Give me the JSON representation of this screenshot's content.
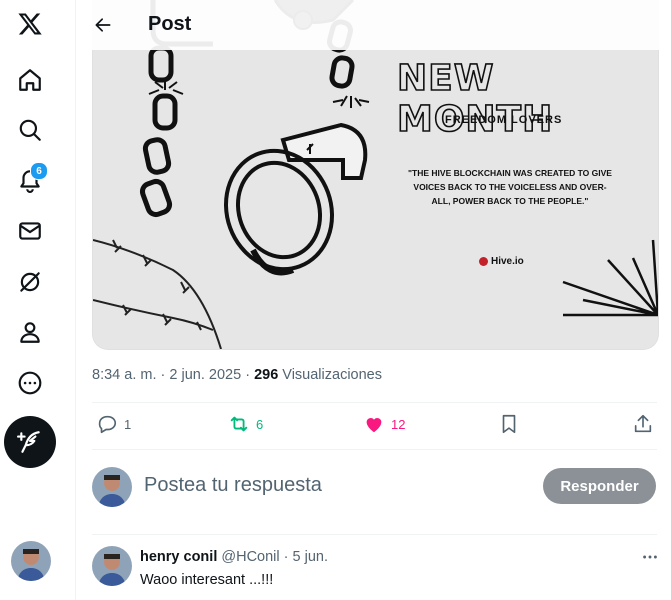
{
  "header": {
    "title": "Post"
  },
  "sidebar": {
    "items": [
      {
        "name": "x-logo"
      },
      {
        "name": "home"
      },
      {
        "name": "explore"
      },
      {
        "name": "notifications",
        "badge": "6"
      },
      {
        "name": "messages"
      },
      {
        "name": "grok"
      },
      {
        "name": "profile"
      },
      {
        "name": "more"
      }
    ],
    "compose": "compose-post"
  },
  "post": {
    "image": {
      "headline": "NEW MONTH",
      "subtitle": "FREEDOM LOVERS",
      "quote": "\"THE HIVE BLOCKCHAIN WAS CREATED TO GIVE VOICES BACK TO THE VOICELESS AND OVER-ALL, POWER BACK TO THE PEOPLE.\"",
      "brand": "Hive.io"
    },
    "time": "8:34 a. m.",
    "sep": "·",
    "date": "2 jun. 2025",
    "views_count": "296",
    "views_label": "Visualizaciones",
    "stats": {
      "replies": "1",
      "reposts": "6",
      "likes": "12"
    }
  },
  "reply_box": {
    "placeholder": "Postea tu respuesta",
    "button": "Responder"
  },
  "comments": [
    {
      "name": "henry conil",
      "handle": "@HConil",
      "sep": "·",
      "date": "5 jun.",
      "text": "Waoo interesant ...!!!"
    }
  ],
  "colors": {
    "like": "#f91880",
    "repost": "#00ba7c",
    "badge": "#1d9bf0",
    "secondary_text": "#536471",
    "reply_button": "#8b9196"
  }
}
